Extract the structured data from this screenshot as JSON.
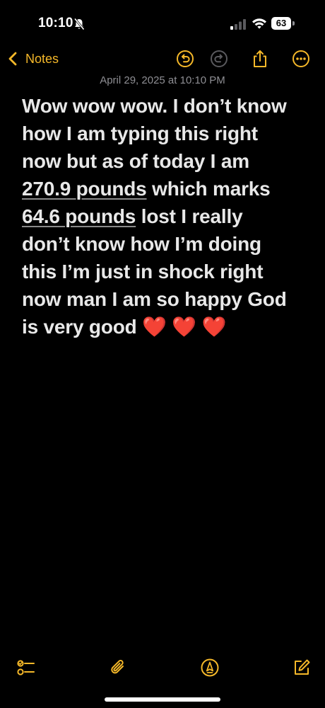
{
  "status_bar": {
    "time": "10:10",
    "battery_level": "63",
    "icons": [
      "bell-slash-icon",
      "cellular-signal-icon",
      "wifi-icon",
      "battery-icon"
    ]
  },
  "nav": {
    "back_label": "Notes",
    "accent_color": "#f5b829",
    "actions": [
      "undo-icon",
      "redo-icon",
      "share-icon",
      "more-icon"
    ]
  },
  "note": {
    "date": "April 29, 2025 at 10:10 PM",
    "lines": {
      "l1": "Wow wow wow. I don’t know",
      "l2": "how I am typing this right",
      "l3": "now but as of today I am",
      "l4_link": "270.9 pounds",
      "l4_rest": " which marks",
      "l5_link": "64.6 pounds",
      "l5_rest": " lost I really",
      "l6": "don’t know how I’m doing",
      "l7": "this I’m just in shock right",
      "l8": "now man I am so happy God",
      "l9": "is very good ",
      "hearts": "❤️ ❤️ ❤️"
    }
  },
  "toolbar": {
    "items": [
      "checklist-icon",
      "attachment-icon",
      "markup-icon",
      "compose-icon"
    ]
  }
}
